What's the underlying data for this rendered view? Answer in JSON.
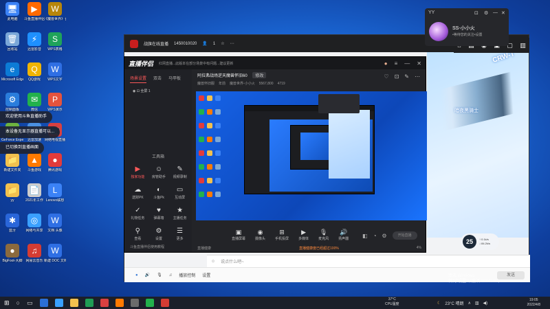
{
  "desktop": {
    "icons": [
      {
        "label": "此电脑",
        "glyph": "🖥",
        "color": "#3b82f6"
      },
      {
        "label": "斗鱼直播伴侣",
        "glyph": "▶",
        "color": "#ff6a00"
      },
      {
        "label": "《魔兽世界》合集",
        "glyph": "W",
        "color": "#b8860b"
      },
      {
        "label": "回收站",
        "glyph": "🗑",
        "color": "#7aa7d8"
      },
      {
        "label": "迅雷影音",
        "glyph": "⚡",
        "color": "#1e90ff"
      },
      {
        "label": "WPS表格",
        "glyph": "S",
        "color": "#1fa35a"
      },
      {
        "label": "Microsoft Edge",
        "glyph": "e",
        "color": "#0c7bd6"
      },
      {
        "label": "QQ游戏",
        "glyph": "Q",
        "color": "#f0b400"
      },
      {
        "label": "WPS文字",
        "glyph": "W",
        "color": "#2f6fe4"
      },
      {
        "label": "控制面板",
        "glyph": "⚙",
        "color": "#2a7ddc"
      },
      {
        "label": "微信",
        "glyph": "✉",
        "color": "#22b14c"
      },
      {
        "label": "WPS演示",
        "glyph": "P",
        "color": "#e5533d"
      },
      {
        "label": "GeForce Experience",
        "glyph": "G",
        "color": "#6db33f"
      },
      {
        "label": "迅雷加速",
        "glyph": "⚡",
        "color": "#4a90e2"
      },
      {
        "label": "网络电视直播",
        "glyph": "📺",
        "color": "#d94040"
      },
      {
        "label": "新建文件夹",
        "glyph": "📁",
        "color": "#f2c14e"
      },
      {
        "label": "斗鱼游戏",
        "glyph": "▲",
        "color": "#ff7a00"
      },
      {
        "label": "腾讯游戏",
        "glyph": "●",
        "color": "#e23b3b"
      },
      {
        "label": "yy",
        "glyph": "📁",
        "color": "#f2c14e"
      },
      {
        "label": "2021年工作",
        "glyph": "📄",
        "color": "#cccccc"
      },
      {
        "label": "Lenovo联想",
        "glyph": "L",
        "color": "#3b82f6"
      },
      {
        "label": "蓝牙",
        "glyph": "✱",
        "color": "#2a66d9"
      },
      {
        "label": "网络与共享",
        "glyph": "◎",
        "color": "#3aa0ff"
      },
      {
        "label": "文档 头像",
        "glyph": "W",
        "color": "#2f6fe4"
      },
      {
        "label": "BigFoot-大脚",
        "glyph": "●",
        "color": "#8b6a3e"
      },
      {
        "label": "网易云音乐",
        "glyph": "♫",
        "color": "#d43c33"
      },
      {
        "label": "新建 DOC 文档",
        "glyph": "W",
        "color": "#2f6fe4"
      }
    ]
  },
  "toasts": [
    "欢迎使用斗鱼直播助手",
    "本设备无显示器直播可以...",
    "已切换到直播画面"
  ],
  "back_window": {
    "title": "战旗在线直播",
    "room_id": "1450010020",
    "count": "1",
    "crw_text": "CRW-T",
    "gun_label": "暗夜黑骑士",
    "chat_placeholder": "说点什么吧~",
    "bottom_items": [
      "播放控制",
      "设置"
    ],
    "send_label": "发送",
    "nav_icons": [
      "⌂",
      "▤",
      "◉",
      "▣",
      "▢",
      "▥"
    ]
  },
  "profile": {
    "name": "SS-小小火",
    "sub": "•等待您的关注•设置",
    "title_tag": "YY"
  },
  "app": {
    "logo": "直播伴侣",
    "notice": "红网直播...此版本在部分场景中有问题...建议更新",
    "tabs": [
      "场景设置",
      "双击",
      "马甲板"
    ],
    "scene_label": "全屏 1",
    "tools_header": "工具箱",
    "tools": [
      {
        "icon": "▶",
        "label": "独家功能",
        "hot": true
      },
      {
        "icon": "☺",
        "label": "房管助手",
        "hot": false
      },
      {
        "icon": "✎",
        "label": "视频录制",
        "hot": false
      },
      {
        "icon": "☁",
        "label": "送财PK",
        "hot": false
      },
      {
        "icon": "◐",
        "label": "斗鱼Pk",
        "hot": false
      },
      {
        "icon": "▭",
        "label": "互动屏",
        "hot": false
      },
      {
        "icon": "✓",
        "label": "礼物任务",
        "hot": false
      },
      {
        "icon": "♥",
        "label": "弹幕墙",
        "hot": false
      },
      {
        "icon": "★",
        "label": "主播任务",
        "hot": false
      },
      {
        "icon": "⚲",
        "label": "查看",
        "hot": false
      },
      {
        "icon": "⚙",
        "label": "设置",
        "hot": false
      },
      {
        "icon": "☰",
        "label": "更多",
        "hot": false
      }
    ],
    "side_footer": "斗鱼直播伴侣使用教程",
    "room_title": "阿拉弗战场逆天魔兽怀旧60",
    "room_title_btn": "修改",
    "room_meta": [
      "魔兽怀旧服",
      "年前",
      "魔兽世界-小小火",
      "5567,800",
      "4719"
    ],
    "room_icons": [
      "♡",
      "⊡",
      "✎",
      "⋯"
    ],
    "controls": [
      {
        "icon": "▣",
        "label": "直播屏幕"
      },
      {
        "icon": "◉",
        "label": "摄像头"
      },
      {
        "icon": "⊞",
        "label": "手机投屏"
      },
      {
        "icon": "▶",
        "label": "多媒体"
      },
      {
        "icon": "🎙",
        "label": "麦克风"
      },
      {
        "icon": "🔊",
        "label": "扬声器"
      }
    ],
    "control_right": [
      "◧",
      "◔",
      "⚙"
    ],
    "live_button": "开始直播",
    "footer_left": "直播健康",
    "footer_warn": "直播健康度已经超过100%",
    "footer_right": "4%"
  },
  "weather_widget": {
    "temp": "25",
    "line1": "↑ 0.1k/s",
    "line2": "↓ 84.2k/s"
  },
  "activate_windows": {
    "line1": "激活 Windows",
    "line2": "转到\"设置\"以激活 Windows。"
  },
  "taskbar": {
    "cpu_temp": "37°C",
    "cpu_label": "CPU温度",
    "weather": "23°C 晴朗",
    "time": "19:05",
    "date": "2022/4/8",
    "app_colors": [
      "#2b6fd6",
      "#39a0ff",
      "#f2c14e",
      "#1f9d55",
      "#d94040",
      "#ff7a00",
      "#6b6b6b",
      "#22b14c",
      "#d43c33"
    ]
  }
}
